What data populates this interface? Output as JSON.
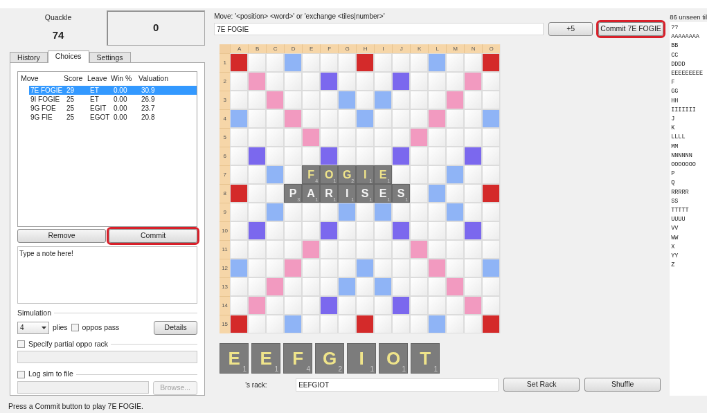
{
  "scoreboard": {
    "players": [
      {
        "name": "Quackle",
        "score": "74"
      },
      {
        "score": "0"
      }
    ]
  },
  "tabs": [
    {
      "label": "History",
      "selected": false
    },
    {
      "label": "Choices",
      "selected": true
    },
    {
      "label": "Settings",
      "selected": false
    }
  ],
  "choices": {
    "columns": [
      "Move",
      "Score",
      "Leave",
      "Win %",
      "Valuation"
    ],
    "rows": [
      {
        "cells": [
          "7E FOGIE",
          "29",
          "ET",
          "0.00",
          "30.9"
        ],
        "selected": true
      },
      {
        "cells": [
          "9I FOGIE",
          "25",
          "ET",
          "0.00",
          "26.9"
        ],
        "selected": false
      },
      {
        "cells": [
          "9G FOE",
          "25",
          "EGIT",
          "0.00",
          "23.7"
        ],
        "selected": false
      },
      {
        "cells": [
          "9G FIE",
          "25",
          "EGOT",
          "0.00",
          "20.8"
        ],
        "selected": false
      }
    ]
  },
  "choice_buttons": [
    {
      "label": "Remove",
      "highlighted": false
    },
    {
      "label": "Commit",
      "highlighted": true
    }
  ],
  "note": {
    "value": "Type a note here!"
  },
  "simulation": {
    "title": "Simulation",
    "plies_value": "4",
    "plies_label": "plies",
    "oppos_pass": {
      "label": "oppos pass",
      "checked": false
    },
    "details_button": "Details",
    "partial_rack": {
      "label": "Specify partial oppo rack",
      "checked": false
    },
    "log": {
      "label": "Log sim to file",
      "checked": false,
      "browse_button": "Browse...",
      "browse_disabled": true
    }
  },
  "move_entry": {
    "hint": "Move: '<position> <word>' or 'exchange <tiles|number>'",
    "value": "7E FOGIE",
    "plus_button": "+5",
    "commit_button": {
      "label": "Commit 7E FOGIE",
      "highlighted": true
    }
  },
  "board": {
    "columns": [
      "A",
      "B",
      "C",
      "D",
      "E",
      "F",
      "G",
      "H",
      "I",
      "J",
      "K",
      "L",
      "M",
      "N",
      "O"
    ],
    "rows": [
      {
        "label": "1",
        "squares": [
          {
            "kind": "tw"
          },
          {
            "kind": "plain"
          },
          {
            "kind": "plain"
          },
          {
            "kind": "dl"
          },
          {
            "kind": "plain"
          },
          {
            "kind": "plain"
          },
          {
            "kind": "plain"
          },
          {
            "kind": "tw"
          },
          {
            "kind": "plain"
          },
          {
            "kind": "plain"
          },
          {
            "kind": "plain"
          },
          {
            "kind": "dl"
          },
          {
            "kind": "plain"
          },
          {
            "kind": "plain"
          },
          {
            "kind": "tw"
          }
        ]
      },
      {
        "label": "2",
        "squares": [
          {
            "kind": "plain"
          },
          {
            "kind": "dw"
          },
          {
            "kind": "plain"
          },
          {
            "kind": "plain"
          },
          {
            "kind": "plain"
          },
          {
            "kind": "tl"
          },
          {
            "kind": "plain"
          },
          {
            "kind": "plain"
          },
          {
            "kind": "plain"
          },
          {
            "kind": "tl"
          },
          {
            "kind": "plain"
          },
          {
            "kind": "plain"
          },
          {
            "kind": "plain"
          },
          {
            "kind": "dw"
          },
          {
            "kind": "plain"
          }
        ]
      },
      {
        "label": "3",
        "squares": [
          {
            "kind": "plain"
          },
          {
            "kind": "plain"
          },
          {
            "kind": "dw"
          },
          {
            "kind": "plain"
          },
          {
            "kind": "plain"
          },
          {
            "kind": "plain"
          },
          {
            "kind": "dl"
          },
          {
            "kind": "plain"
          },
          {
            "kind": "dl"
          },
          {
            "kind": "plain"
          },
          {
            "kind": "plain"
          },
          {
            "kind": "plain"
          },
          {
            "kind": "dw"
          },
          {
            "kind": "plain"
          },
          {
            "kind": "plain"
          }
        ]
      },
      {
        "label": "4",
        "squares": [
          {
            "kind": "dl"
          },
          {
            "kind": "plain"
          },
          {
            "kind": "plain"
          },
          {
            "kind": "dw"
          },
          {
            "kind": "plain"
          },
          {
            "kind": "plain"
          },
          {
            "kind": "plain"
          },
          {
            "kind": "dl"
          },
          {
            "kind": "plain"
          },
          {
            "kind": "plain"
          },
          {
            "kind": "plain"
          },
          {
            "kind": "dw"
          },
          {
            "kind": "plain"
          },
          {
            "kind": "plain"
          },
          {
            "kind": "dl"
          }
        ]
      },
      {
        "label": "5",
        "squares": [
          {
            "kind": "plain"
          },
          {
            "kind": "plain"
          },
          {
            "kind": "plain"
          },
          {
            "kind": "plain"
          },
          {
            "kind": "dw"
          },
          {
            "kind": "plain"
          },
          {
            "kind": "plain"
          },
          {
            "kind": "plain"
          },
          {
            "kind": "plain"
          },
          {
            "kind": "plain"
          },
          {
            "kind": "dw"
          },
          {
            "kind": "plain"
          },
          {
            "kind": "plain"
          },
          {
            "kind": "plain"
          },
          {
            "kind": "plain"
          }
        ]
      },
      {
        "label": "6",
        "squares": [
          {
            "kind": "plain"
          },
          {
            "kind": "tl"
          },
          {
            "kind": "plain"
          },
          {
            "kind": "plain"
          },
          {
            "kind": "plain"
          },
          {
            "kind": "tl"
          },
          {
            "kind": "plain"
          },
          {
            "kind": "plain"
          },
          {
            "kind": "plain"
          },
          {
            "kind": "tl"
          },
          {
            "kind": "plain"
          },
          {
            "kind": "plain"
          },
          {
            "kind": "plain"
          },
          {
            "kind": "tl"
          },
          {
            "kind": "plain"
          }
        ]
      },
      {
        "label": "7",
        "squares": [
          {
            "kind": "plain"
          },
          {
            "kind": "plain"
          },
          {
            "kind": "dl"
          },
          {
            "kind": "plain"
          },
          {
            "kind": "tile",
            "letter": "F",
            "value": "4",
            "recent": true
          },
          {
            "kind": "tile",
            "letter": "O",
            "value": "1",
            "recent": true
          },
          {
            "kind": "tile",
            "letter": "G",
            "value": "2",
            "recent": true
          },
          {
            "kind": "tile",
            "letter": "I",
            "value": "1",
            "recent": true
          },
          {
            "kind": "tile",
            "letter": "E",
            "value": "1",
            "recent": true
          },
          {
            "kind": "plain"
          },
          {
            "kind": "plain"
          },
          {
            "kind": "plain"
          },
          {
            "kind": "dl"
          },
          {
            "kind": "plain"
          },
          {
            "kind": "plain"
          }
        ]
      },
      {
        "label": "8",
        "squares": [
          {
            "kind": "tw"
          },
          {
            "kind": "plain"
          },
          {
            "kind": "plain"
          },
          {
            "kind": "tile",
            "letter": "P",
            "value": "3",
            "recent": false
          },
          {
            "kind": "tile",
            "letter": "A",
            "value": "1",
            "recent": false
          },
          {
            "kind": "tile",
            "letter": "R",
            "value": "1",
            "recent": false
          },
          {
            "kind": "tile",
            "letter": "I",
            "value": "1",
            "recent": false
          },
          {
            "kind": "tile",
            "letter": "S",
            "value": "1",
            "recent": false
          },
          {
            "kind": "tile",
            "letter": "E",
            "value": "1",
            "recent": false
          },
          {
            "kind": "tile",
            "letter": "S",
            "value": "1",
            "recent": false
          },
          {
            "kind": "plain"
          },
          {
            "kind": "dl"
          },
          {
            "kind": "plain"
          },
          {
            "kind": "plain"
          },
          {
            "kind": "tw"
          }
        ]
      },
      {
        "label": "9",
        "squares": [
          {
            "kind": "plain"
          },
          {
            "kind": "plain"
          },
          {
            "kind": "dl"
          },
          {
            "kind": "plain"
          },
          {
            "kind": "plain"
          },
          {
            "kind": "plain"
          },
          {
            "kind": "dl"
          },
          {
            "kind": "plain"
          },
          {
            "kind": "dl"
          },
          {
            "kind": "plain"
          },
          {
            "kind": "plain"
          },
          {
            "kind": "plain"
          },
          {
            "kind": "dl"
          },
          {
            "kind": "plain"
          },
          {
            "kind": "plain"
          }
        ]
      },
      {
        "label": "10",
        "squares": [
          {
            "kind": "plain"
          },
          {
            "kind": "tl"
          },
          {
            "kind": "plain"
          },
          {
            "kind": "plain"
          },
          {
            "kind": "plain"
          },
          {
            "kind": "tl"
          },
          {
            "kind": "plain"
          },
          {
            "kind": "plain"
          },
          {
            "kind": "plain"
          },
          {
            "kind": "tl"
          },
          {
            "kind": "plain"
          },
          {
            "kind": "plain"
          },
          {
            "kind": "plain"
          },
          {
            "kind": "tl"
          },
          {
            "kind": "plain"
          }
        ]
      },
      {
        "label": "11",
        "squares": [
          {
            "kind": "plain"
          },
          {
            "kind": "plain"
          },
          {
            "kind": "plain"
          },
          {
            "kind": "plain"
          },
          {
            "kind": "dw"
          },
          {
            "kind": "plain"
          },
          {
            "kind": "plain"
          },
          {
            "kind": "plain"
          },
          {
            "kind": "plain"
          },
          {
            "kind": "plain"
          },
          {
            "kind": "dw"
          },
          {
            "kind": "plain"
          },
          {
            "kind": "plain"
          },
          {
            "kind": "plain"
          },
          {
            "kind": "plain"
          }
        ]
      },
      {
        "label": "12",
        "squares": [
          {
            "kind": "dl"
          },
          {
            "kind": "plain"
          },
          {
            "kind": "plain"
          },
          {
            "kind": "dw"
          },
          {
            "kind": "plain"
          },
          {
            "kind": "plain"
          },
          {
            "kind": "plain"
          },
          {
            "kind": "dl"
          },
          {
            "kind": "plain"
          },
          {
            "kind": "plain"
          },
          {
            "kind": "plain"
          },
          {
            "kind": "dw"
          },
          {
            "kind": "plain"
          },
          {
            "kind": "plain"
          },
          {
            "kind": "dl"
          }
        ]
      },
      {
        "label": "13",
        "squares": [
          {
            "kind": "plain"
          },
          {
            "kind": "plain"
          },
          {
            "kind": "dw"
          },
          {
            "kind": "plain"
          },
          {
            "kind": "plain"
          },
          {
            "kind": "plain"
          },
          {
            "kind": "dl"
          },
          {
            "kind": "plain"
          },
          {
            "kind": "dl"
          },
          {
            "kind": "plain"
          },
          {
            "kind": "plain"
          },
          {
            "kind": "plain"
          },
          {
            "kind": "dw"
          },
          {
            "kind": "plain"
          },
          {
            "kind": "plain"
          }
        ]
      },
      {
        "label": "14",
        "squares": [
          {
            "kind": "plain"
          },
          {
            "kind": "dw"
          },
          {
            "kind": "plain"
          },
          {
            "kind": "plain"
          },
          {
            "kind": "plain"
          },
          {
            "kind": "tl"
          },
          {
            "kind": "plain"
          },
          {
            "kind": "plain"
          },
          {
            "kind": "plain"
          },
          {
            "kind": "tl"
          },
          {
            "kind": "plain"
          },
          {
            "kind": "plain"
          },
          {
            "kind": "plain"
          },
          {
            "kind": "dw"
          },
          {
            "kind": "plain"
          }
        ]
      },
      {
        "label": "15",
        "squares": [
          {
            "kind": "tw"
          },
          {
            "kind": "plain"
          },
          {
            "kind": "plain"
          },
          {
            "kind": "dl"
          },
          {
            "kind": "plain"
          },
          {
            "kind": "plain"
          },
          {
            "kind": "plain"
          },
          {
            "kind": "tw"
          },
          {
            "kind": "plain"
          },
          {
            "kind": "plain"
          },
          {
            "kind": "plain"
          },
          {
            "kind": "dl"
          },
          {
            "kind": "plain"
          },
          {
            "kind": "plain"
          },
          {
            "kind": "tw"
          }
        ]
      }
    ]
  },
  "rack": {
    "tiles": [
      {
        "letter": "E",
        "value": "1"
      },
      {
        "letter": "E",
        "value": "1"
      },
      {
        "letter": "F",
        "value": "4"
      },
      {
        "letter": "G",
        "value": "2"
      },
      {
        "letter": "I",
        "value": "1"
      },
      {
        "letter": "O",
        "value": "1"
      },
      {
        "letter": "T",
        "value": "1"
      }
    ],
    "label": "'s rack:",
    "value": "EEFGIOT",
    "set_button": "Set Rack",
    "shuffle_button": "Shuffle"
  },
  "unseen": {
    "title": "86 unseen til",
    "lines": [
      "??",
      "AAAAAAAA",
      "BB",
      "CC",
      "DDDD",
      "EEEEEEEEE",
      "F",
      "GG",
      "HH",
      "IIIIIII",
      "J",
      "K",
      "LLLL",
      "MM",
      "NNNNNN",
      "OOOOOOO",
      "P",
      "Q",
      "RRRRR",
      "SS",
      "TTTTT",
      "UUUU",
      "VV",
      "WW",
      "X",
      "YY",
      "Z"
    ]
  },
  "status_bar": "Press a Commit button to play 7E FOGIE."
}
